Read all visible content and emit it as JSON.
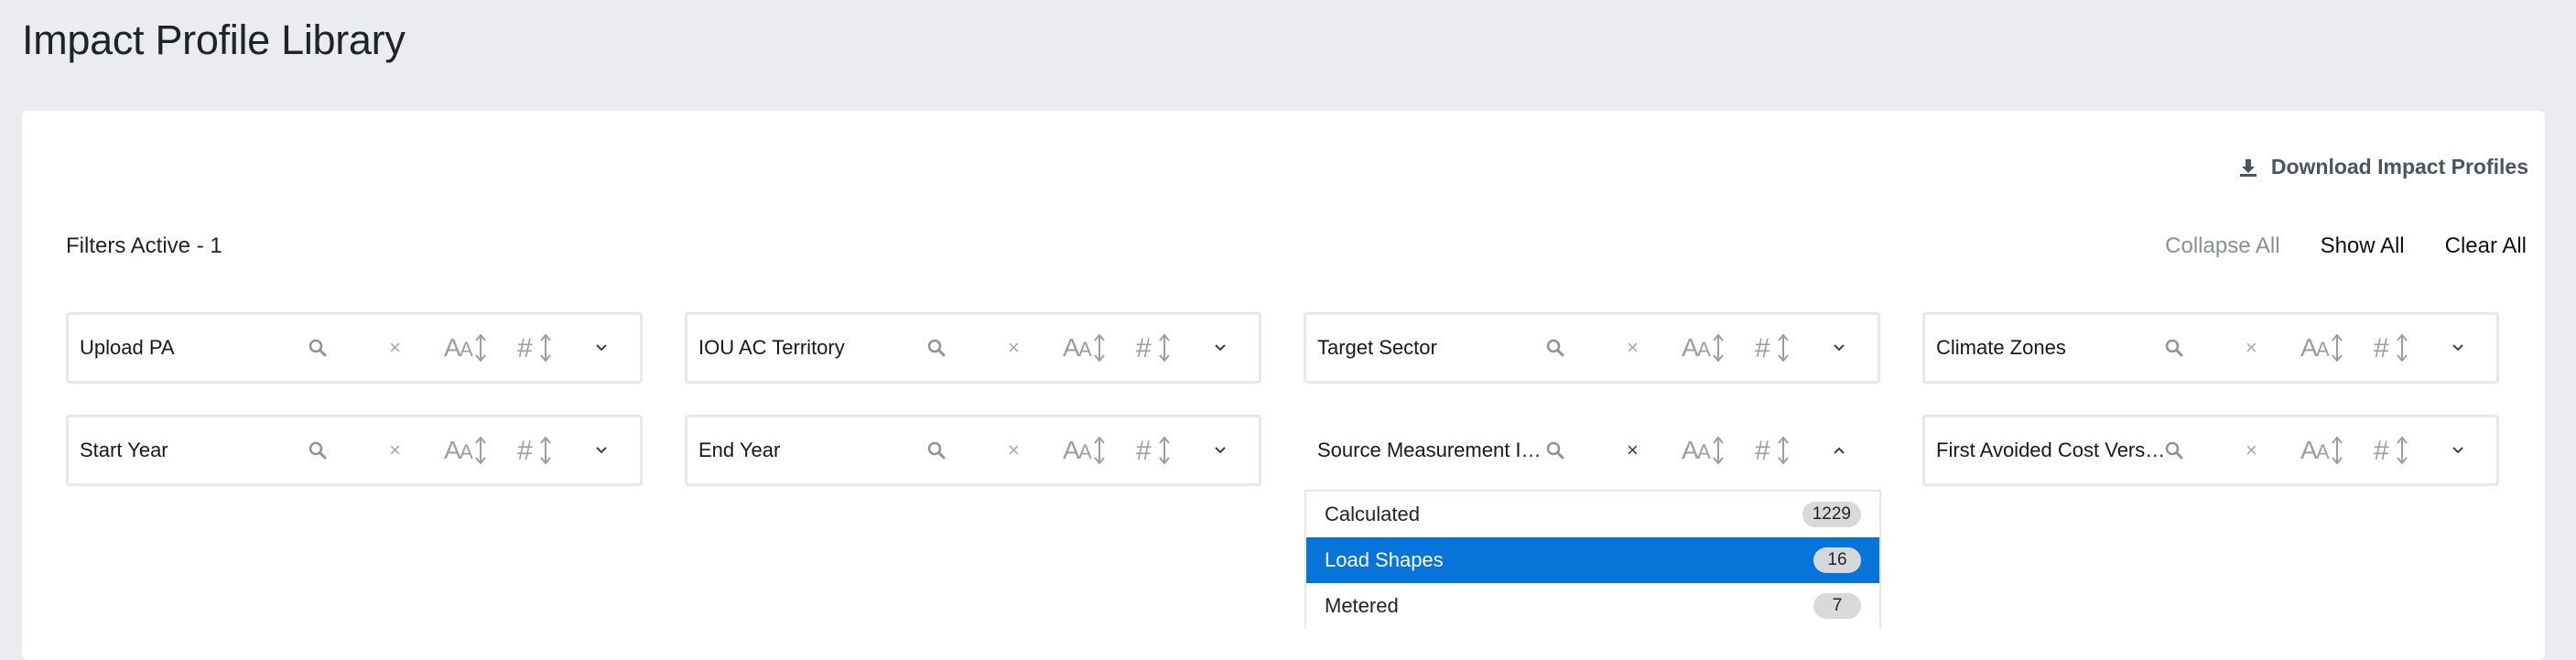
{
  "page": {
    "title": "Impact Profile Library"
  },
  "toolbar": {
    "download_label": "Download Impact Profiles"
  },
  "filters_summary": {
    "text": "Filters Active - 1"
  },
  "actions": {
    "collapse_all": "Collapse All",
    "show_all": "Show All",
    "clear_all": "Clear All"
  },
  "filter_controls": {
    "clear_glyph": "×"
  },
  "filters": [
    {
      "label": "Upload PA"
    },
    {
      "label": "IOU AC Territory"
    },
    {
      "label": "Target Sector"
    },
    {
      "label": "Climate Zones"
    },
    {
      "label": "Start Year"
    },
    {
      "label": "End Year"
    },
    {
      "label": "Source Measurement Impact Type"
    },
    {
      "label": "First Avoided Cost Version"
    }
  ],
  "dropdown": {
    "open_filter": "Source Measurement Impact Type",
    "options": [
      {
        "label": "Calculated",
        "count": "1229",
        "selected": false
      },
      {
        "label": "Load Shapes",
        "count": "16",
        "selected": true
      },
      {
        "label": "Metered",
        "count": "7",
        "selected": false
      }
    ]
  },
  "colors": {
    "accent": "#0674d8",
    "background": "#ebecef",
    "card": "#ffffff"
  },
  "icons": {
    "download": "download-icon",
    "search": "search-icon",
    "clear": "clear-icon",
    "sort_alpha": "sort-alpha-icon",
    "sort_numeric": "sort-numeric-icon",
    "chevron_down": "chevron-down-icon",
    "chevron_up": "chevron-up-icon"
  }
}
